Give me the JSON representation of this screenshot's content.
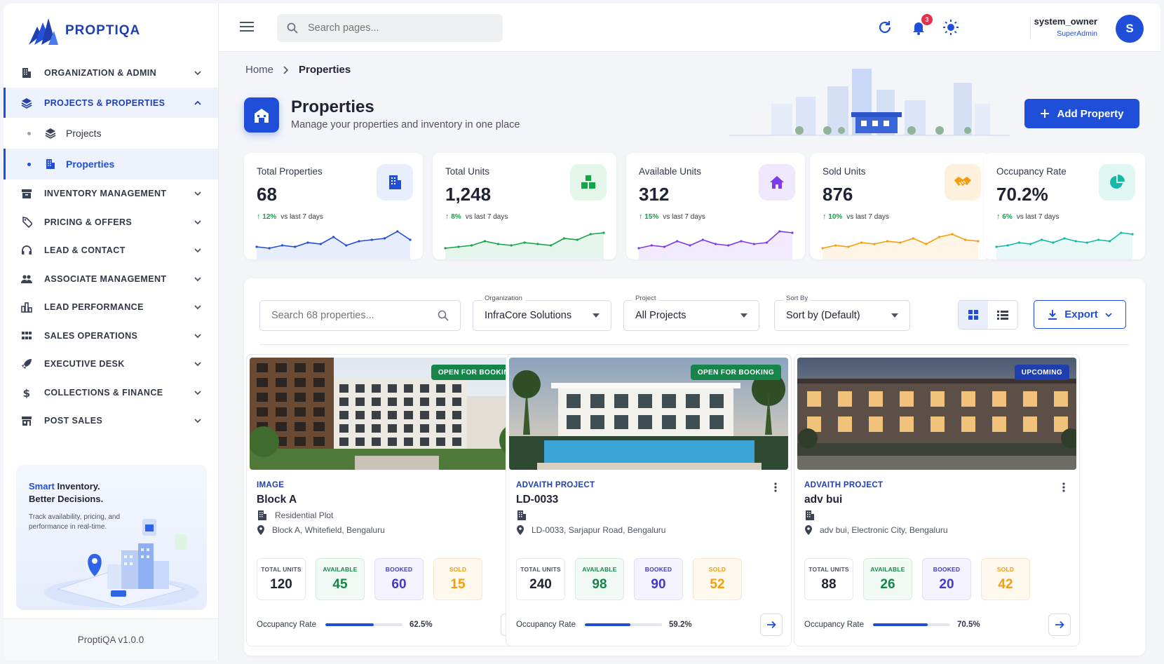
{
  "app": {
    "name": "PROPTIQA",
    "version": "ProptiQA v1.0.0"
  },
  "sidebar": {
    "items": [
      {
        "label": "ORGANIZATION & ADMIN",
        "icon": "building-icon",
        "expanded": false
      },
      {
        "label": "PROJECTS & PROPERTIES",
        "icon": "layers-icon",
        "expanded": true,
        "active": true
      },
      {
        "label": "INVENTORY MANAGEMENT",
        "icon": "archive-icon",
        "expanded": false
      },
      {
        "label": "PRICING & OFFERS",
        "icon": "price-tag-icon",
        "expanded": false
      },
      {
        "label": "LEAD & CONTACT",
        "icon": "headset-icon",
        "expanded": false
      },
      {
        "label": "ASSOCIATE MANAGEMENT",
        "icon": "people-icon",
        "expanded": false
      },
      {
        "label": "LEAD PERFORMANCE",
        "icon": "bar-chart-icon",
        "expanded": false
      },
      {
        "label": "SALES OPERATIONS",
        "icon": "grid-icon",
        "expanded": false
      },
      {
        "label": "EXECUTIVE DESK",
        "icon": "rocket-icon",
        "expanded": false
      },
      {
        "label": "COLLECTIONS & FINANCE",
        "icon": "dollar-icon",
        "expanded": false
      },
      {
        "label": "POST SALES",
        "icon": "store-icon",
        "expanded": false
      }
    ],
    "subitems": [
      {
        "label": "Projects",
        "icon": "layers-icon",
        "active": false
      },
      {
        "label": "Properties",
        "icon": "building-icon",
        "active": true
      }
    ],
    "promo": {
      "highlight": "Smart",
      "title_rest": " Inventory.",
      "title_line2": "Better Decisions.",
      "desc": "Track availability, pricing, and performance in real-time."
    }
  },
  "topbar": {
    "search_placeholder": "Search pages...",
    "notification_count": "3",
    "user_name": "system_owner",
    "user_role": "SuperAdmin",
    "avatar_letter": "S"
  },
  "breadcrumb": {
    "home": "Home",
    "current": "Properties"
  },
  "page": {
    "title": "Properties",
    "subtitle": "Manage your properties and inventory in one place",
    "add_button": "Add Property"
  },
  "stats": [
    {
      "title": "Total Properties",
      "value": "68",
      "change": "12%",
      "period": "vs last 7 days",
      "icon": "building-icon",
      "color": "#1f4fd8",
      "bg": "#e8eefc",
      "spark": [
        0.25,
        0.2,
        0.3,
        0.25,
        0.4,
        0.35,
        0.6,
        0.3,
        0.45,
        0.5,
        0.55,
        0.8,
        0.5
      ]
    },
    {
      "title": "Total Units",
      "value": "1,248",
      "change": "8%",
      "period": "vs last 7 days",
      "icon": "blocks-icon",
      "color": "#16a34a",
      "bg": "#e4f6ea",
      "spark": [
        0.2,
        0.25,
        0.3,
        0.45,
        0.35,
        0.3,
        0.4,
        0.35,
        0.3,
        0.55,
        0.5,
        0.7,
        0.75
      ]
    },
    {
      "title": "Available Units",
      "value": "312",
      "change": "15%",
      "period": "vs last 7 days",
      "icon": "home-icon",
      "color": "#7c3aed",
      "bg": "#f0e9fd",
      "spark": [
        0.2,
        0.3,
        0.25,
        0.45,
        0.3,
        0.5,
        0.35,
        0.3,
        0.45,
        0.35,
        0.4,
        0.8,
        0.75
      ]
    },
    {
      "title": "Sold Units",
      "value": "876",
      "change": "10%",
      "period": "vs last 7 days",
      "icon": "handshake-icon",
      "color": "#f59e0b",
      "bg": "#fdf1de",
      "spark": [
        0.2,
        0.3,
        0.25,
        0.4,
        0.35,
        0.45,
        0.4,
        0.55,
        0.35,
        0.6,
        0.7,
        0.5,
        0.45
      ]
    },
    {
      "title": "Occupancy Rate",
      "value": "70.2%",
      "change": "6%",
      "period": "vs last 7 days",
      "icon": "pie-chart-icon",
      "color": "#14b8a6",
      "bg": "#e0f6f3",
      "spark": [
        0.25,
        0.3,
        0.4,
        0.35,
        0.5,
        0.4,
        0.55,
        0.45,
        0.4,
        0.5,
        0.45,
        0.75,
        0.7
      ]
    }
  ],
  "filters": {
    "search_placeholder": "Search 68 properties...",
    "organization_label": "Organization",
    "organization_value": "InfraCore Solutions",
    "project_label": "Project",
    "project_value": "All Projects",
    "sort_label": "Sort By",
    "sort_value": "Sort by (Default)",
    "export_label": "Export"
  },
  "properties": [
    {
      "status": "OPEN FOR BOOKING",
      "status_color": "#17854a",
      "project": "IMAGE",
      "name": "Block A",
      "type": "Residential Plot",
      "location": "Block A, Whitefield, Bengaluru",
      "total_label": "TOTAL UNITS",
      "total": "120",
      "available_label": "AVAILABLE",
      "available": "45",
      "booked_label": "BOOKED",
      "booked": "60",
      "sold_label": "SOLD",
      "sold": "15",
      "occ_label": "Occupancy Rate",
      "occupancy": "62.5%",
      "occ_value": 62.5
    },
    {
      "status": "OPEN FOR BOOKING",
      "status_color": "#17854a",
      "project": "ADVAITH PROJECT",
      "name": "LD-0033",
      "type": "",
      "location": "LD-0033, Sarjapur Road, Bengaluru",
      "total_label": "TOTAL UNITS",
      "total": "240",
      "available_label": "AVAILABLE",
      "available": "98",
      "booked_label": "BOOKED",
      "booked": "90",
      "sold_label": "SOLD",
      "sold": "52",
      "occ_label": "Occupancy Rate",
      "occupancy": "59.2%",
      "occ_value": 59.2
    },
    {
      "status": "UPCOMING",
      "status_color": "#1f3fae",
      "project": "ADVAITH PROJECT",
      "name": "adv bui",
      "type": "",
      "location": "adv bui, Electronic City, Bengaluru",
      "total_label": "TOTAL UNITS",
      "total": "88",
      "available_label": "AVAILABLE",
      "available": "26",
      "booked_label": "BOOKED",
      "booked": "20",
      "sold_label": "SOLD",
      "sold": "42",
      "occ_label": "Occupancy Rate",
      "occupancy": "70.5%",
      "occ_value": 70.5
    }
  ]
}
